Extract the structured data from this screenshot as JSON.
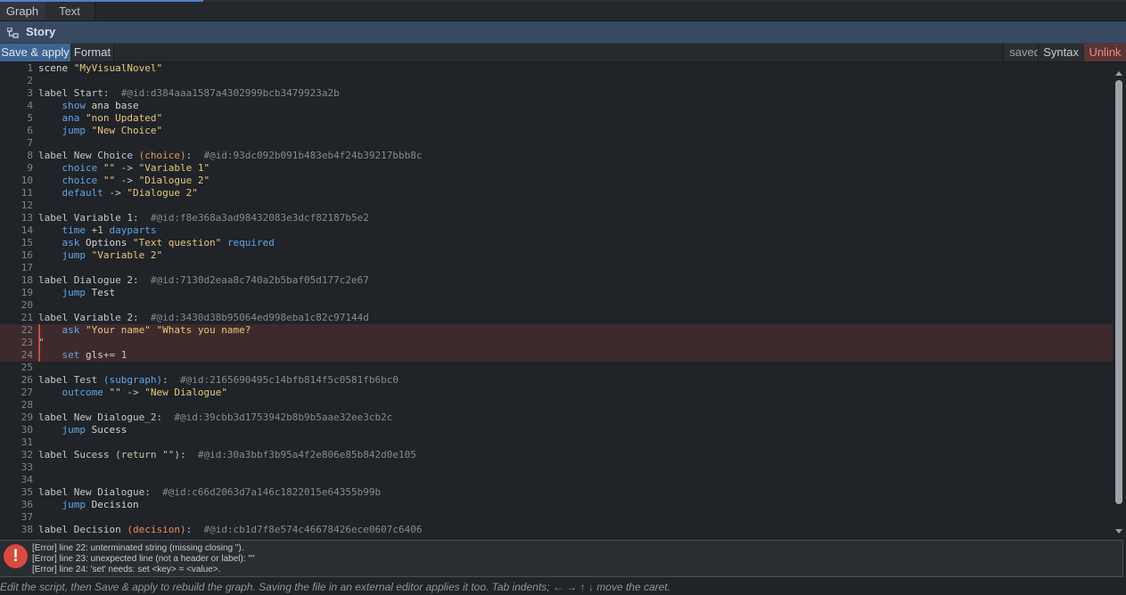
{
  "tabs": {
    "graph": "Graph",
    "text": "Text"
  },
  "story": {
    "title": "Story",
    "icon": "tree-icon"
  },
  "toolbar": {
    "save_apply": "Save & apply",
    "format": "Format",
    "saved": "saved",
    "syntax": "Syntax",
    "unlink": "Unlink"
  },
  "lines": [
    {
      "n": "1",
      "s": [
        [
          "k-plain",
          "scene "
        ],
        [
          "k-str",
          "\"MyVisualNovel\""
        ]
      ]
    },
    {
      "n": "2",
      "s": []
    },
    {
      "n": "3",
      "s": [
        [
          "k-label",
          "label Start:"
        ],
        [
          "k-id",
          "  #@id:d384aaa1587a4302999bcb3479923a2b"
        ]
      ]
    },
    {
      "n": "4",
      "s": [
        [
          "k-kw",
          "    show "
        ],
        [
          "k-plain",
          "ana base"
        ]
      ]
    },
    {
      "n": "5",
      "s": [
        [
          "k-kw",
          "    ana "
        ],
        [
          "k-str",
          "\"non Updated\""
        ]
      ]
    },
    {
      "n": "6",
      "s": [
        [
          "k-kw",
          "    jump "
        ],
        [
          "k-str",
          "\"New Choice\""
        ]
      ]
    },
    {
      "n": "7",
      "s": []
    },
    {
      "n": "8",
      "s": [
        [
          "k-label",
          "label New Choice "
        ],
        [
          "k-paren",
          "(choice)"
        ],
        [
          "k-label",
          ":"
        ],
        [
          "k-id",
          "  #@id:93dc092b091b483eb4f24b39217bbb8c"
        ]
      ]
    },
    {
      "n": "9",
      "s": [
        [
          "k-kw",
          "    choice "
        ],
        [
          "k-str",
          "\"\""
        ],
        [
          "k-op",
          " -> "
        ],
        [
          "k-str",
          "\"Variable 1\""
        ]
      ]
    },
    {
      "n": "10",
      "s": [
        [
          "k-kw",
          "    choice "
        ],
        [
          "k-str",
          "\"\""
        ],
        [
          "k-op",
          " -> "
        ],
        [
          "k-str",
          "\"Dialogue 2\""
        ]
      ]
    },
    {
      "n": "11",
      "s": [
        [
          "k-kw",
          "    default "
        ],
        [
          "k-op",
          "-> "
        ],
        [
          "k-str",
          "\"Dialogue 2\""
        ]
      ]
    },
    {
      "n": "12",
      "s": []
    },
    {
      "n": "13",
      "s": [
        [
          "k-label",
          "label Variable 1:"
        ],
        [
          "k-id",
          "  #@id:f8e368a3ad98432083e3dcf82187b5e2"
        ]
      ]
    },
    {
      "n": "14",
      "s": [
        [
          "k-kw",
          "    time "
        ],
        [
          "k-num",
          "+1 "
        ],
        [
          "k-kw",
          "dayparts"
        ]
      ]
    },
    {
      "n": "15",
      "s": [
        [
          "k-kw",
          "    ask "
        ],
        [
          "k-plain",
          "Options "
        ],
        [
          "k-str",
          "\"Text question\" "
        ],
        [
          "k-kw",
          "required"
        ]
      ]
    },
    {
      "n": "16",
      "s": [
        [
          "k-kw",
          "    jump "
        ],
        [
          "k-str",
          "\"Variable 2\""
        ]
      ]
    },
    {
      "n": "17",
      "s": []
    },
    {
      "n": "18",
      "s": [
        [
          "k-label",
          "label Dialogue 2:"
        ],
        [
          "k-id",
          "  #@id:7130d2eaa8c740a2b5baf05d177c2e67"
        ]
      ]
    },
    {
      "n": "19",
      "s": [
        [
          "k-kw",
          "    jump "
        ],
        [
          "k-plain",
          "Test"
        ]
      ]
    },
    {
      "n": "20",
      "s": []
    },
    {
      "n": "21",
      "s": [
        [
          "k-label",
          "label Variable 2:"
        ],
        [
          "k-id",
          "  #@id:3430d38b95064ed998eba1c82c97144d"
        ]
      ]
    },
    {
      "n": "22",
      "err": true,
      "s": [
        [
          "k-kw",
          "    ask "
        ],
        [
          "k-str",
          "\"Your name\" \"Whats you name?"
        ]
      ]
    },
    {
      "n": "23",
      "err": true,
      "s": [
        [
          "k-quote",
          "\""
        ]
      ]
    },
    {
      "n": "24",
      "err": true,
      "s": [
        [
          "k-kw",
          "    set "
        ],
        [
          "k-plain",
          "gls"
        ],
        [
          "k-num",
          "+= 1"
        ]
      ]
    },
    {
      "n": "25",
      "s": []
    },
    {
      "n": "26",
      "s": [
        [
          "k-label",
          "label Test "
        ],
        [
          "k-kw",
          "(subgraph)"
        ],
        [
          "k-label",
          ":"
        ],
        [
          "k-id",
          "  #@id:2165690495c14bfb814f5c0581fb6bc0"
        ]
      ]
    },
    {
      "n": "27",
      "s": [
        [
          "k-kw",
          "    outcome "
        ],
        [
          "k-str",
          "\"\""
        ],
        [
          "k-op",
          " -> "
        ],
        [
          "k-str",
          "\"New Dialogue\""
        ]
      ]
    },
    {
      "n": "28",
      "s": []
    },
    {
      "n": "29",
      "s": [
        [
          "k-label",
          "label New Dialogue_2:"
        ],
        [
          "k-id",
          "  #@id:39cbb3d1753942b8b9b5aae32ee3cb2c"
        ]
      ]
    },
    {
      "n": "30",
      "s": [
        [
          "k-kw",
          "    jump "
        ],
        [
          "k-plain",
          "Sucess"
        ]
      ]
    },
    {
      "n": "31",
      "s": []
    },
    {
      "n": "32",
      "s": [
        [
          "k-label",
          "label Sucess "
        ],
        [
          "k-ret",
          "(return \"\")"
        ],
        [
          "k-label",
          ":"
        ],
        [
          "k-id",
          "  #@id:30a3bbf3b95a4f2e806e85b842d0e105"
        ]
      ]
    },
    {
      "n": "33",
      "s": []
    },
    {
      "n": "34",
      "s": []
    },
    {
      "n": "35",
      "s": [
        [
          "k-label",
          "label New Dialogue:"
        ],
        [
          "k-id",
          "  #@id:c66d2063d7a146c1822015e64355b99b"
        ]
      ]
    },
    {
      "n": "36",
      "s": [
        [
          "k-kw",
          "    jump "
        ],
        [
          "k-plain",
          "Decision"
        ]
      ]
    },
    {
      "n": "37",
      "s": []
    },
    {
      "n": "38",
      "s": [
        [
          "k-label",
          "label Decision "
        ],
        [
          "k-dec",
          "(decision)"
        ],
        [
          "k-label",
          ":"
        ],
        [
          "k-id",
          "  #@id:cb1d7f8e574c46678426ece0607c6406"
        ]
      ]
    }
  ],
  "errors": {
    "icon": "error-icon",
    "lines": [
      "[Error] line 22: unterminated string (missing closing \").",
      "[Error] line 23: unexpected line (not a header or label): '\"'",
      "[Error] line 24: 'set' needs: set <key> = <value>."
    ]
  },
  "footer": "Edit the script, then Save & apply to rebuild the graph. Saving the file in an external editor applies it too. Tab indents; ← → ↑ ↓ move the caret."
}
